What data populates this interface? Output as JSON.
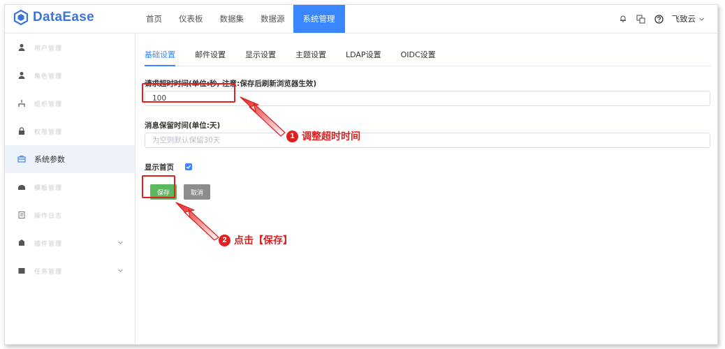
{
  "app": {
    "logo_text": "DataEase"
  },
  "nav": {
    "items": [
      {
        "label": "首页"
      },
      {
        "label": "仪表板"
      },
      {
        "label": "数据集"
      },
      {
        "label": "数据源"
      },
      {
        "label": "系统管理",
        "active": true
      }
    ]
  },
  "header": {
    "user_name": "飞致云"
  },
  "sidebar": {
    "items": [
      {
        "label": "用户管理"
      },
      {
        "label": "角色管理"
      },
      {
        "label": "组织管理"
      },
      {
        "label": "权限管理"
      },
      {
        "label": "系统参数",
        "active": true
      },
      {
        "label": "模板管理"
      },
      {
        "label": "操作日志"
      },
      {
        "label": "插件管理"
      },
      {
        "label": "任务管理"
      }
    ]
  },
  "tabs": [
    {
      "label": "基础设置",
      "active": true
    },
    {
      "label": "邮件设置"
    },
    {
      "label": "显示设置"
    },
    {
      "label": "主题设置"
    },
    {
      "label": "LDAP设置"
    },
    {
      "label": "OIDC设置"
    }
  ],
  "form": {
    "timeout_label": "请求超时时间(单位:秒, 注意:保存后刷新浏览器生效)",
    "timeout_value": "100",
    "retention_label": "消息保留时间(单位:天)",
    "retention_placeholder": "为空则默认保留30天",
    "show_home_label": "显示首页",
    "save_label": "保存",
    "cancel_label": "取消"
  },
  "annotations": {
    "step1_num": "1",
    "step1_text": "调整超时时间",
    "step2_num": "2",
    "step2_text": "点击【保存】"
  },
  "colors": {
    "primary": "#3a86ff",
    "accent_red": "#e02020",
    "save_green": "#5cb85c"
  }
}
